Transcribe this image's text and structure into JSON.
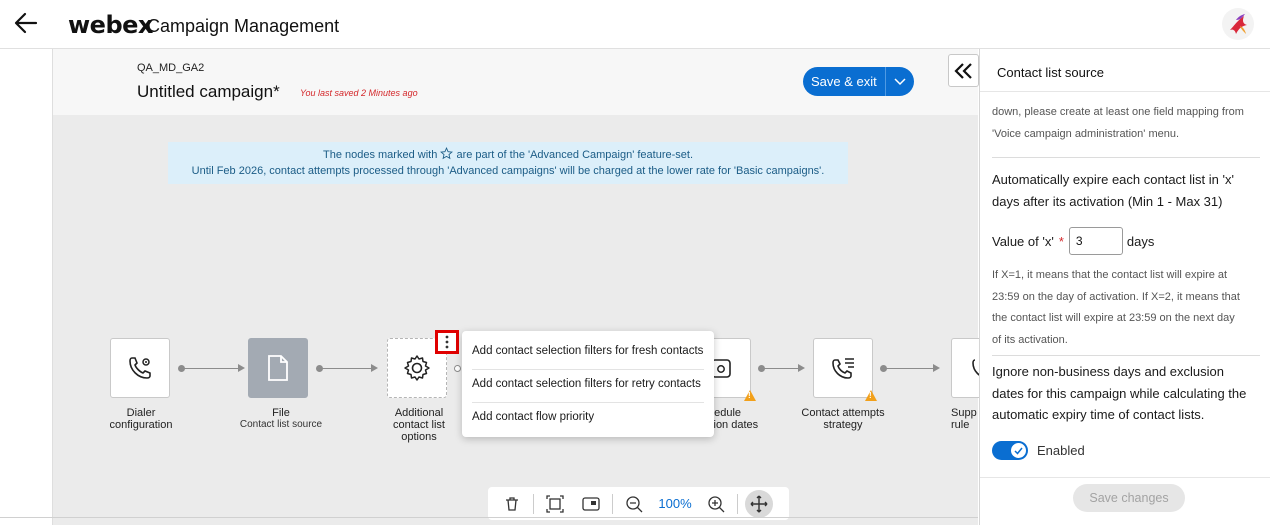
{
  "header": {
    "brand": "webex",
    "app_title": "Campaign Management"
  },
  "campaign": {
    "code": "QA_MD_GA2",
    "name": "Untitled campaign*",
    "saved_note": "You last saved 2 Minutes ago",
    "save_label": "Save & exit"
  },
  "banner": {
    "line1_pre": "The nodes marked with",
    "line1_post": "are part of the 'Advanced Campaign' feature-set.",
    "line2": "Until Feb 2026, contact attempts processed through 'Advanced campaigns' will be charged at the lower rate for 'Basic campaigns'."
  },
  "nodes": {
    "dialer": "Dialer configuration",
    "file_title": "File",
    "file_sub": "Contact list source",
    "additional": "Additional contact list options",
    "schedule": "Schedule exclusion dates",
    "schedule_visible_l1": "hedule",
    "schedule_visible_l2": "sion dates",
    "attempts": "Contact attempts strategy",
    "supp_visible_l1": "Supp",
    "supp_visible_l2": "rule"
  },
  "context_menu": {
    "items": [
      "Add contact selection filters for fresh contacts",
      "Add contact selection filters for retry contacts",
      "Add contact flow priority"
    ]
  },
  "toolbar": {
    "zoom": "100%",
    "icons": [
      "trash-icon",
      "fit-screen-icon",
      "minimap-icon",
      "zoom-out-icon",
      "zoom-in-icon",
      "pan-move-icon"
    ]
  },
  "panel": {
    "title": "Contact list source",
    "top_fragment": "y                    y      pp g   p",
    "intro_l1": "down, please create at least one field mapping from",
    "intro_l2": "'Voice campaign administration' menu.",
    "expire_l1": "Automatically expire each contact list in 'x'",
    "expire_l2": "days after its activation (Min 1 - Max 31)",
    "value_label": "Value of 'x'",
    "required_mark": "*",
    "value": "3",
    "unit": "days",
    "hint_l1": "If X=1, it means that the contact list will expire at",
    "hint_l2": "23:59 on the day of activation. If X=2, it means that",
    "hint_l3": "the contact list will expire at 23:59 on the next day",
    "hint_l4": "of its activation.",
    "ignore_l1": "Ignore non-business days and exclusion",
    "ignore_l2": "dates for this campaign while calculating the",
    "ignore_l3": "automatic expiry time of contact lists.",
    "toggle_label": "Enabled",
    "toggle_on": true,
    "save_changes": "Save changes"
  },
  "colors": {
    "accent": "#0a6ed1",
    "warning": "#f2a01a",
    "error": "#d4282b",
    "highlight": "#e00000"
  }
}
